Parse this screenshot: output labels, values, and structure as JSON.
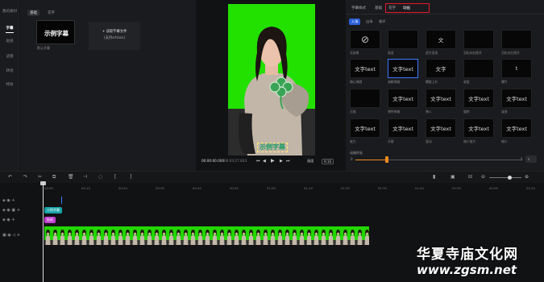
{
  "sidebar": {
    "items": [
      {
        "label": "我的素材"
      },
      {
        "label": "字幕"
      },
      {
        "label": "贴纸"
      },
      {
        "label": "滤镜"
      },
      {
        "label": "转场"
      },
      {
        "label": "特效"
      }
    ],
    "active_index": 1
  },
  "left_panel": {
    "tabs": [
      {
        "label": "基础"
      },
      {
        "label": "花字"
      }
    ],
    "sample_card": {
      "title": "示例字幕",
      "caption": "默认字幕"
    },
    "import_card": {
      "line1": "+ 读取字幕文件",
      "line2": "(支持srt/ass)"
    }
  },
  "preview": {
    "subtitle_text": "示例字幕",
    "time_current": "00:00:00.000",
    "time_total": "00:03:27.833",
    "fit_label": "画面",
    "ratio_label": "9:16"
  },
  "right_panel": {
    "tabs": [
      {
        "label": "字幕样式"
      },
      {
        "label": "基础"
      },
      {
        "label": "花字"
      },
      {
        "label": "动画"
      }
    ],
    "active_tab": 3,
    "subtabs": [
      {
        "label": "入场"
      },
      {
        "label": "出场"
      },
      {
        "label": "循环"
      }
    ],
    "effects": [
      {
        "label": "无效果",
        "preview": ""
      },
      {
        "label": "渐显",
        "preview": ""
      },
      {
        "label": "逐字显现",
        "preview": "文"
      },
      {
        "label": "羽化向右擦开",
        "preview": ""
      },
      {
        "label": "羽化向左擦开",
        "preview": ""
      },
      {
        "label": "随心弹跳",
        "preview": "文字text"
      },
      {
        "label": "溶解弹跳",
        "preview": "文字text"
      },
      {
        "label": "螺旋上升",
        "preview": "文字"
      },
      {
        "label": "收拢",
        "preview": ""
      },
      {
        "label": "爆竹",
        "preview": "t"
      },
      {
        "label": "压缩",
        "preview": ""
      },
      {
        "label": "弹性伸缩",
        "preview": "文字text"
      },
      {
        "label": "弹入",
        "preview": "文字text"
      },
      {
        "label": "旋转",
        "preview": "文字text"
      },
      {
        "label": "波浪",
        "preview": "文字text"
      },
      {
        "label": "放大",
        "preview": "文字text"
      },
      {
        "label": "开幕",
        "preview": "文字text"
      },
      {
        "label": "晃动",
        "preview": "文字text"
      },
      {
        "label": "缩小放大",
        "preview": "文字text"
      },
      {
        "label": "缩小",
        "preview": "文字text"
      }
    ],
    "duration_label": "动画时长",
    "slider_min": "0",
    "slider_max": "5",
    "slider_value_fraction": 0.19,
    "unit_label": "s"
  },
  "timeline": {
    "ruler": [
      "00:00",
      "00:10",
      "00:20",
      "00:30",
      "00:40",
      "00:50",
      "01:00",
      "01:10",
      "01:20",
      "01:30",
      "01:40",
      "01:50",
      "02:00",
      "02:10"
    ],
    "clips": [
      {
        "label": "示例字幕",
        "color": "#17a3a8"
      },
      {
        "label": "贴纸",
        "color": "#c13fd1"
      }
    ]
  },
  "watermark": {
    "cn": "华夏寺庙文化网",
    "url": "www.zgsm.net"
  }
}
